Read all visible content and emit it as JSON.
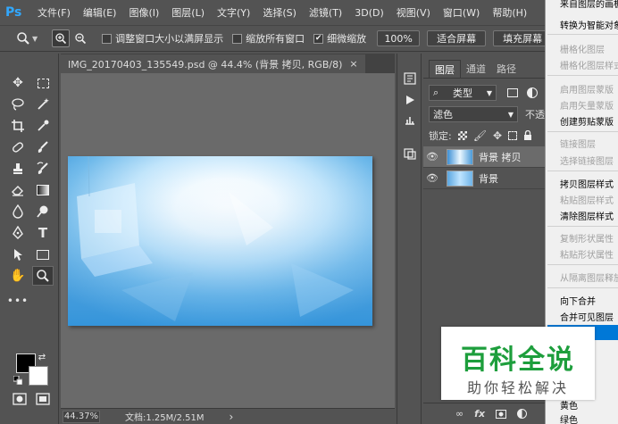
{
  "app": {
    "logo": "Ps"
  },
  "menu": [
    "文件(F)",
    "编辑(E)",
    "图像(I)",
    "图层(L)",
    "文字(Y)",
    "选择(S)",
    "滤镜(T)",
    "3D(D)",
    "视图(V)",
    "窗口(W)",
    "帮助(H)"
  ],
  "options": {
    "resize_windows": "调整窗口大小以满屏显示",
    "zoom_all": "缩放所有窗口",
    "scrubby_zoom": "细微缩放",
    "scrubby_checked": "✔",
    "zoom_value": "100%",
    "fit_screen": "适合屏幕",
    "fill_screen": "填充屏幕"
  },
  "document": {
    "tab_title": "IMG_20170403_135549.psd @ 44.4% (背景 拷贝, RGB/8)",
    "close_glyph": "×"
  },
  "status": {
    "zoom": "44.37%",
    "doc_size": "文档:1.25M/2.51M",
    "arrow": "›"
  },
  "layers_panel": {
    "tabs": [
      "图层",
      "通道",
      "路径"
    ],
    "filter_label": "类型",
    "blend_mode": "滤色",
    "opacity_label": "不透",
    "lock_label": "锁定:",
    "layers": [
      {
        "name": "背景 拷贝",
        "selected": true
      },
      {
        "name": "背景",
        "selected": false
      }
    ],
    "footer": [
      "∞",
      "fx"
    ]
  },
  "context_menu": {
    "items": [
      {
        "label": "来自图层的画板",
        "disabled": false
      },
      {
        "label": "转换为智能对象",
        "disabled": false
      },
      {
        "label": "栅格化图层",
        "disabled": true
      },
      {
        "label": "栅格化图层样式",
        "disabled": true
      },
      {
        "label": "启用图层蒙版",
        "disabled": true
      },
      {
        "label": "启用矢量蒙版",
        "disabled": true
      },
      {
        "label": "创建剪贴蒙版",
        "disabled": false
      },
      {
        "label": "链接图层",
        "disabled": true
      },
      {
        "label": "选择链接图层",
        "disabled": true
      },
      {
        "label": "拷贝图层样式",
        "disabled": false
      },
      {
        "label": "粘贴图层样式",
        "disabled": true
      },
      {
        "label": "清除图层样式",
        "disabled": false
      },
      {
        "label": "复制形状属性",
        "disabled": true
      },
      {
        "label": "粘贴形状属性",
        "disabled": true
      },
      {
        "label": "从隔离图层释放",
        "disabled": true
      },
      {
        "label": "向下合并",
        "disabled": false
      },
      {
        "label": "合并可见图层",
        "disabled": false
      },
      {
        "label": "黄色",
        "disabled": false
      },
      {
        "label": "绿色",
        "disabled": false
      }
    ]
  },
  "watermark": {
    "title": "百科全说",
    "subtitle": "助你轻松解决"
  },
  "colors": {
    "accent": "#31a8ff",
    "highlight": "#0078d7",
    "watermark_green": "#1d9e3c"
  }
}
